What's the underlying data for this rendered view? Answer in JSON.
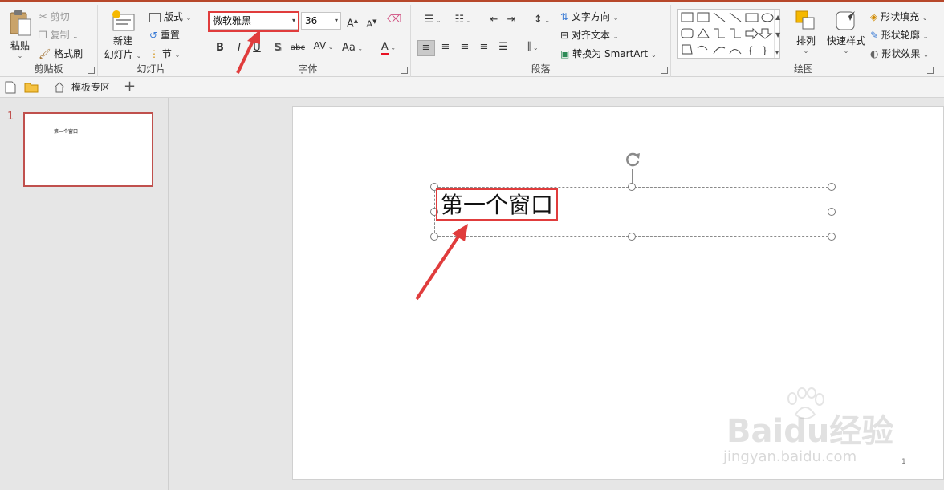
{
  "ribbon": {
    "clipboard": {
      "paste_label": "粘贴",
      "cut_label": "剪切",
      "copy_label": "复制",
      "format_painter_label": "格式刷",
      "group_label": "剪贴板"
    },
    "slides": {
      "new_slide_label_line1": "新建",
      "new_slide_label_line2": "幻灯片",
      "layout_label": "版式",
      "reset_label": "重置",
      "section_label": "节",
      "group_label": "幻灯片"
    },
    "font": {
      "font_name": "微软雅黑",
      "font_size": "36",
      "bold": "B",
      "italic": "I",
      "underline": "U",
      "shadow": "S",
      "strikethrough": "abc",
      "spacing": "AV",
      "change_case": "Aa",
      "font_color": "A",
      "grow": "A",
      "shrink": "A",
      "group_label": "字体"
    },
    "paragraph": {
      "text_direction_label": "文字方向",
      "align_text_label": "对齐文本",
      "smartart_label": "转换为 SmartArt",
      "group_label": "段落"
    },
    "drawing": {
      "arrange_label": "排列",
      "quick_styles_label": "快速样式",
      "shape_fill_label": "形状填充",
      "shape_outline_label": "形状轮廓",
      "shape_effects_label": "形状效果",
      "group_label": "绘图"
    }
  },
  "quickbar": {
    "template_tab_label": "模板专区",
    "add_label": "+"
  },
  "thumbnails": {
    "slide_number": "1",
    "thumb_text": "第一个窗口"
  },
  "slide": {
    "title_text": "第一个窗口",
    "page_number": "1"
  },
  "watermark": {
    "brand": "Baidu经验",
    "url": "jingyan.baidu.com"
  },
  "colors": {
    "accent": "#b7472a",
    "highlight": "#e03c3c",
    "font_color_underline": "#e81123"
  }
}
